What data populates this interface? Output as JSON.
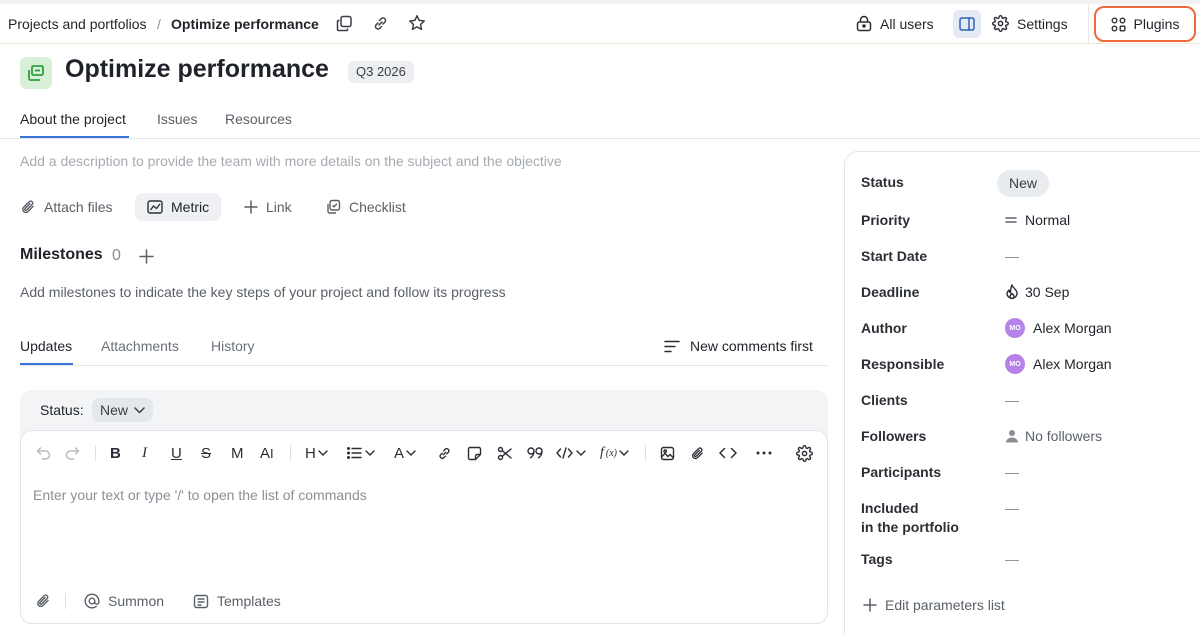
{
  "breadcrumb": {
    "parent": "Projects and portfolios",
    "separator": "/",
    "current": "Optimize performance"
  },
  "topbar": {
    "access_label": "All users",
    "settings_label": "Settings",
    "plugins_label": "Plugins"
  },
  "project": {
    "title": "Optimize performance",
    "badge": "Q3 2026",
    "icon": "portfolio-icon",
    "icon_color": "#2e9f3a"
  },
  "tabs": [
    {
      "label": "About the project",
      "active": true
    },
    {
      "label": "Issues",
      "active": false
    },
    {
      "label": "Resources",
      "active": false
    }
  ],
  "description_placeholder": "Add a description to provide the team with more details on the subject and the objective",
  "actions": {
    "attach": "Attach files",
    "metric": "Metric",
    "link": "Link",
    "checklist": "Checklist"
  },
  "milestones": {
    "title": "Milestones",
    "count": "0",
    "hint": "Add milestones to indicate the key steps of your project and follow its progress"
  },
  "activity_tabs": [
    {
      "label": "Updates",
      "active": true
    },
    {
      "label": "Attachments",
      "active": false
    },
    {
      "label": "History",
      "active": false
    }
  ],
  "sort_label": "New comments first",
  "editor": {
    "status_label": "Status:",
    "status_value": "New",
    "placeholder": "Enter your text or type '/' to open the list of commands",
    "summon_label": "Summon",
    "templates_label": "Templates"
  },
  "details": {
    "status": {
      "label": "Status",
      "value": "New"
    },
    "priority": {
      "label": "Priority",
      "value": "Normal"
    },
    "start_date": {
      "label": "Start Date",
      "value": "—"
    },
    "deadline": {
      "label": "Deadline",
      "value": "30 Sep"
    },
    "author": {
      "label": "Author",
      "value": "Alex Morgan",
      "initials": "MO"
    },
    "responsible": {
      "label": "Responsible",
      "value": "Alex Morgan",
      "initials": "MO"
    },
    "clients": {
      "label": "Clients",
      "value": "—"
    },
    "followers": {
      "label": "Followers",
      "value": "No followers"
    },
    "participants": {
      "label": "Participants",
      "value": "—"
    },
    "portfolio": {
      "label_line1": "Included",
      "label_line2": "in the portfolio",
      "value": "—"
    },
    "tags": {
      "label": "Tags",
      "value": "—"
    },
    "edit_params": "Edit parameters list"
  },
  "colors": {
    "accent": "#3a73d8",
    "plugins_border": "#ef6a3a",
    "avatar": "#b583e8"
  }
}
